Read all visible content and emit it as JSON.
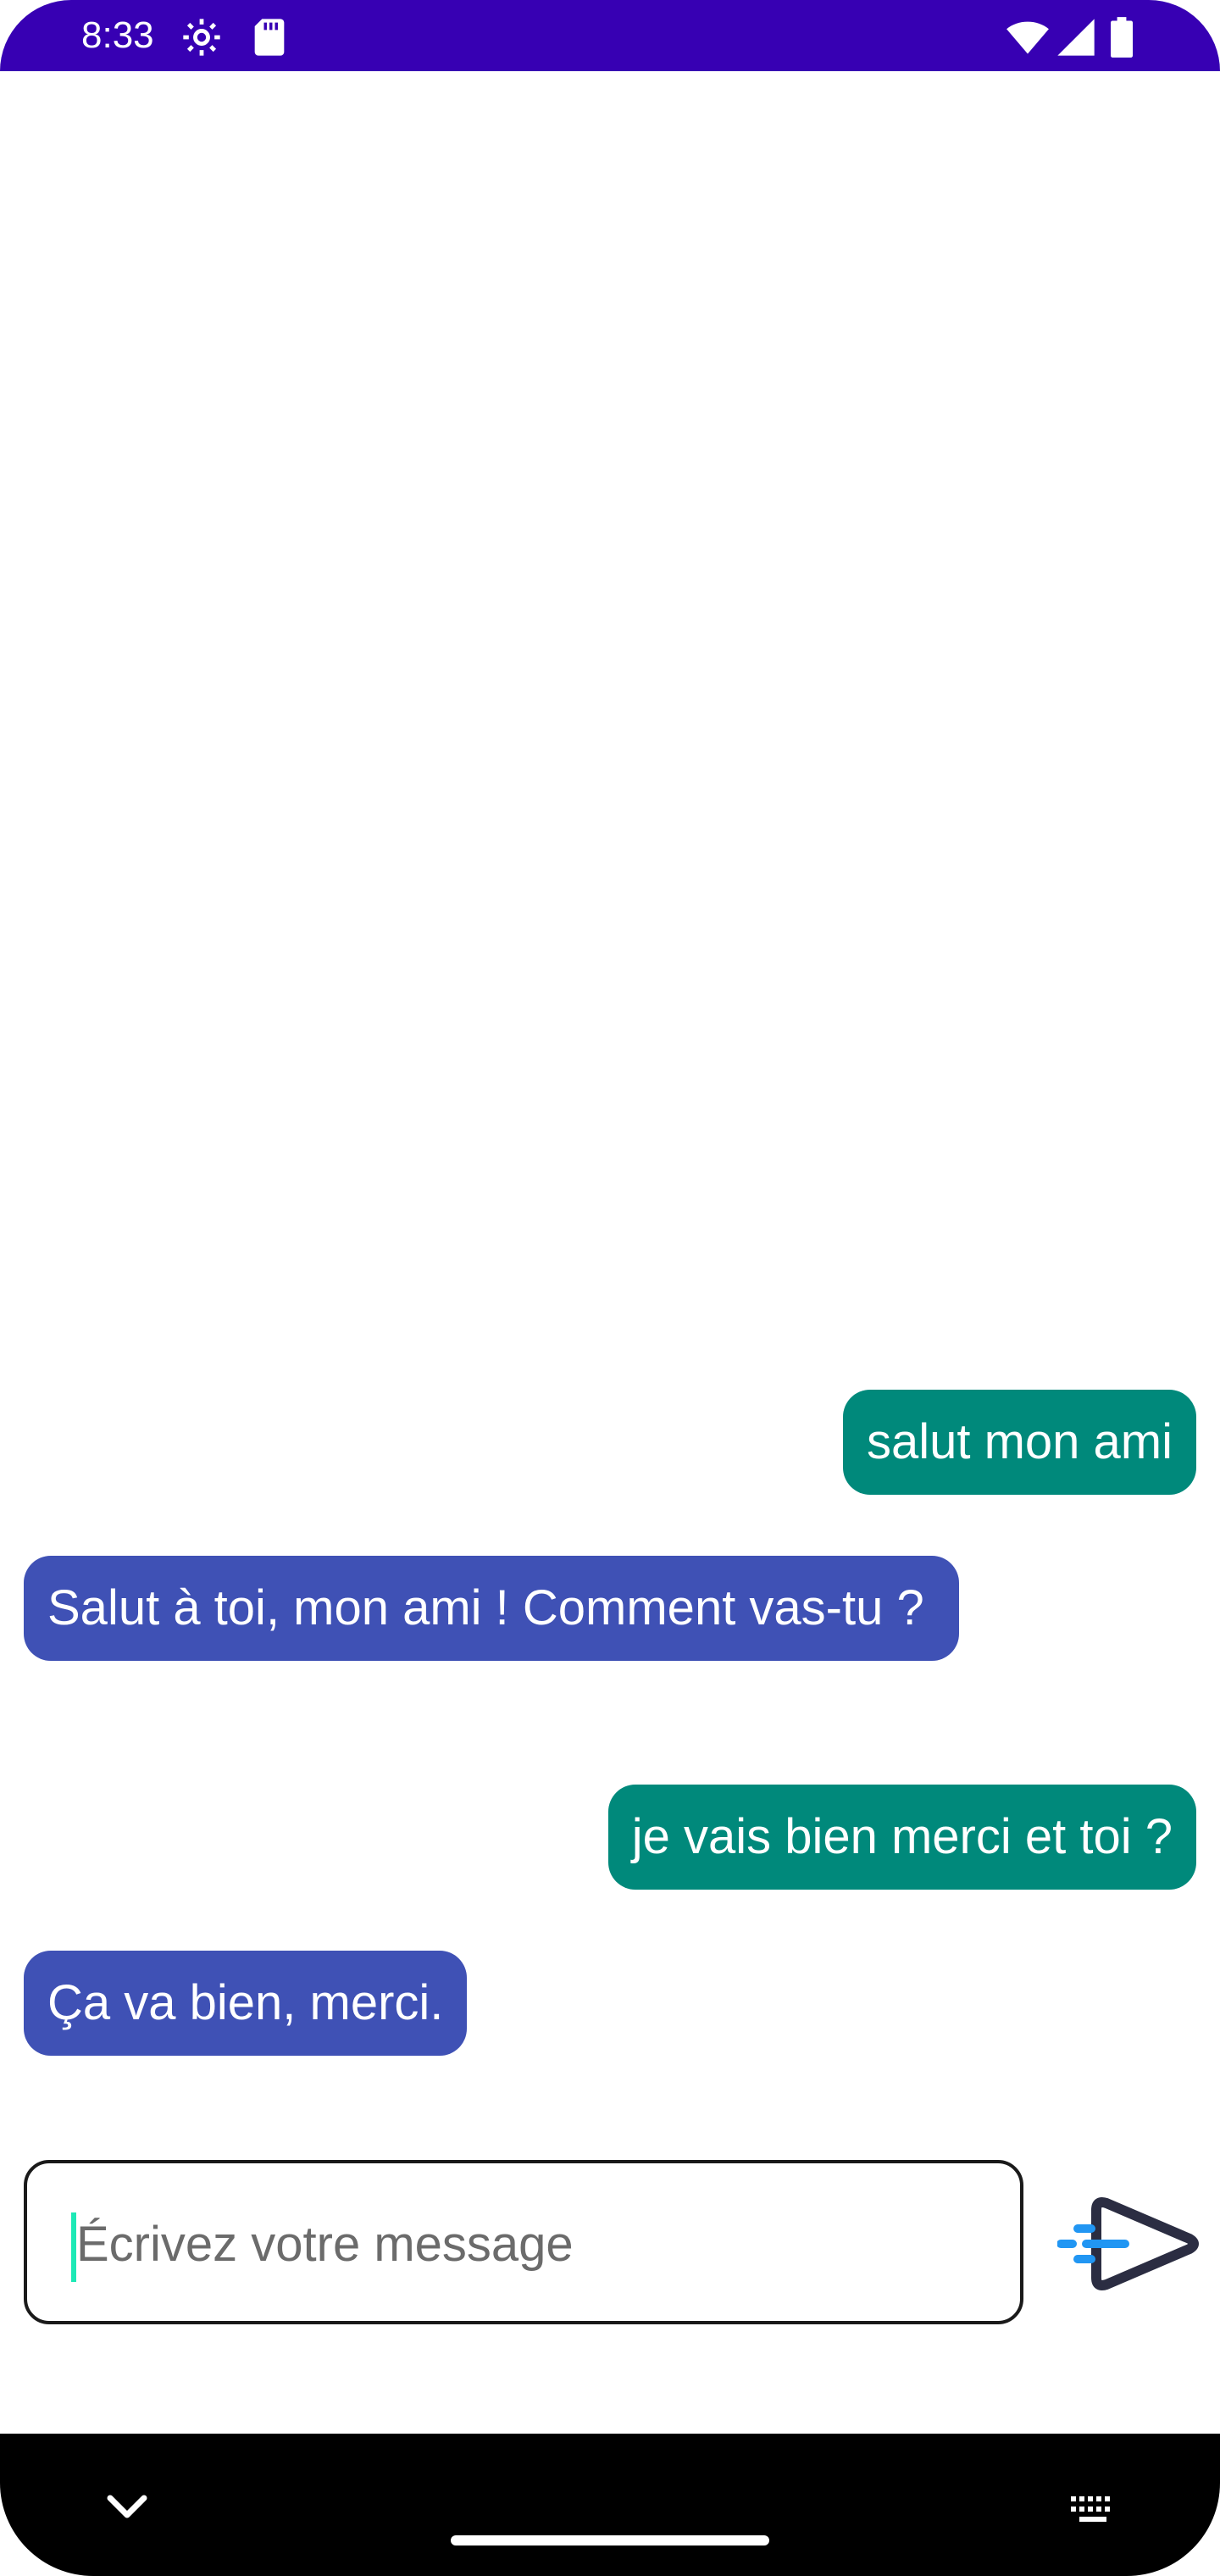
{
  "status_bar": {
    "time": "8:33",
    "icons": [
      "settings-gear-icon",
      "sd-card-icon",
      "wifi-icon",
      "signal-icon",
      "battery-icon"
    ],
    "background_color": "#3700B3"
  },
  "messages": [
    {
      "sender": "user",
      "text": "salut mon ami"
    },
    {
      "sender": "bot",
      "text": "Salut à toi, mon ami ! Comment vas-tu ?"
    },
    {
      "sender": "user",
      "text": "je vais bien merci et toi ?"
    },
    {
      "sender": "bot",
      "text": "Ça va bien, merci."
    }
  ],
  "composer": {
    "value": "",
    "placeholder": "Écrivez votre message",
    "send_icon": "send-icon"
  },
  "nav_bar": {
    "icons": [
      "chevron-down-icon",
      "home-handle",
      "keyboard-icon"
    ]
  },
  "colors": {
    "user_bubble": "#00897B",
    "bot_bubble": "#3F51B5",
    "accent_caret": "#1DE9B6",
    "send_icon_accent": "#2196F3",
    "send_icon_outline": "#2B2D42"
  }
}
